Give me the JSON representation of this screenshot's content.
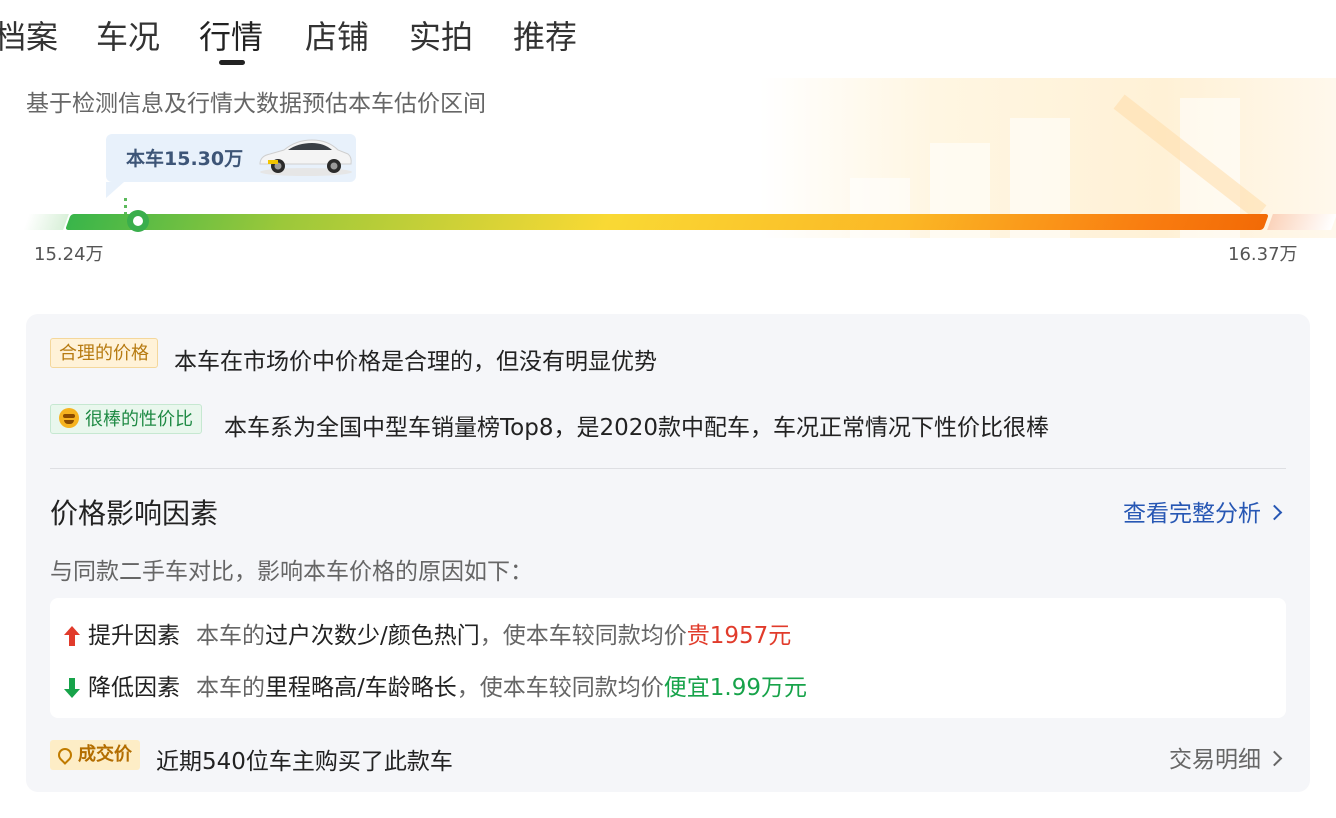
{
  "tabs": [
    {
      "label": "档案"
    },
    {
      "label": "车况"
    },
    {
      "label": "行情"
    },
    {
      "label": "店铺"
    },
    {
      "label": "实拍"
    },
    {
      "label": "推荐"
    }
  ],
  "active_tab": "行情",
  "estimate": {
    "subtitle": "基于检测信息及行情大数据预估本车估价区间",
    "car_price_label": "本车15.30万",
    "min_label": "15.24万",
    "max_label": "16.37万",
    "min_value": 15.24,
    "max_value": 16.37,
    "car_value": 15.3
  },
  "assessment": {
    "price_tag": "合理的价格",
    "price_text": "本车在市场价中价格是合理的，但没有明显优势",
    "value_tag": "很棒的性价比",
    "value_text": "本车系为全国中型车销量榜Top8，是2020款中配车，车况正常情况下性价比很棒"
  },
  "factors_section": {
    "title": "价格影响因素",
    "link": "查看完整分析",
    "note": "与同款二手车对比，影响本车价格的原因如下：",
    "up": {
      "label": "提升因素",
      "prefix": "本车的",
      "reason": "过户次数少/颜色热门",
      "middle": "，使本车较同款均价",
      "effect": "贵1957元"
    },
    "down": {
      "label": "降低因素",
      "prefix": "本车的",
      "reason": "里程略高/车龄略长",
      "middle": "，使本车较同款均价",
      "effect": "便宜1.99万元"
    }
  },
  "deal": {
    "tag": "成交价",
    "text": "近期540位车主购买了此款车",
    "link": "交易明细"
  },
  "colors": {
    "up": "#e13b2b",
    "down": "#17a34a",
    "link": "#2757b4"
  },
  "icons": [
    "arrow-up-icon",
    "arrow-down-icon",
    "chevron-right-icon",
    "smile-emoji-icon",
    "deal-tag-icon"
  ]
}
